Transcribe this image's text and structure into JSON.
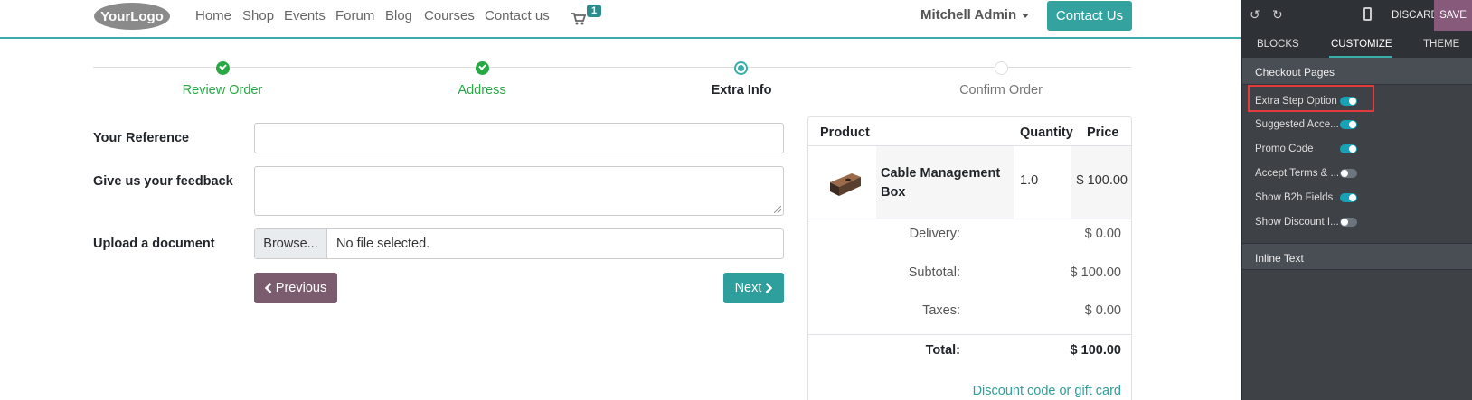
{
  "navbar": {
    "logo_text": "YourLogo",
    "links": [
      "Home",
      "Shop",
      "Events",
      "Forum",
      "Blog",
      "Courses",
      "Contact us"
    ],
    "cart_count": "1",
    "user_name": "Mitchell Admin",
    "contact_button": "Contact Us"
  },
  "steps": [
    {
      "label": "Review Order",
      "state": "done"
    },
    {
      "label": "Address",
      "state": "done"
    },
    {
      "label": "Extra Info",
      "state": "current"
    },
    {
      "label": "Confirm Order",
      "state": "todo"
    }
  ],
  "form": {
    "reference_label": "Your Reference",
    "reference_value": "",
    "feedback_label": "Give us your feedback",
    "feedback_value": "",
    "upload_label": "Upload a document",
    "browse_label": "Browse...",
    "file_status": "No file selected.",
    "previous_label": "Previous",
    "next_label": "Next"
  },
  "summary": {
    "headers": {
      "product": "Product",
      "quantity": "Quantity",
      "price": "Price"
    },
    "item": {
      "name": "Cable Management Box",
      "quantity": "1.0",
      "price": "$ 100.00"
    },
    "delivery_label": "Delivery:",
    "delivery_value": "$ 0.00",
    "subtotal_label": "Subtotal:",
    "subtotal_value": "$ 100.00",
    "taxes_label": "Taxes:",
    "taxes_value": "$ 0.00",
    "total_label": "Total:",
    "total_value": "$ 100.00",
    "discount_link": "Discount code or gift card"
  },
  "editor": {
    "discard_label": "DISCARD",
    "save_label": "SAVE",
    "tabs": [
      "BLOCKS",
      "CUSTOMIZE",
      "THEME"
    ],
    "active_tab": "CUSTOMIZE",
    "section_checkout": "Checkout Pages",
    "options": [
      {
        "label": "Extra Step Option",
        "on": true
      },
      {
        "label": "Suggested Acce...",
        "on": true
      },
      {
        "label": "Promo Code",
        "on": true
      },
      {
        "label": "Accept Terms & ...",
        "on": false
      },
      {
        "label": "Show B2b Fields",
        "on": true
      },
      {
        "label": "Show Discount I...",
        "on": false
      }
    ],
    "section_inline": "Inline Text"
  },
  "colors": {
    "accent": "#3aadaa",
    "success": "#28a745",
    "previous_button": "#7a5c6e",
    "save_button": "#875a7b",
    "editor_bg": "#3e4247",
    "highlight": "#e33b3b"
  }
}
